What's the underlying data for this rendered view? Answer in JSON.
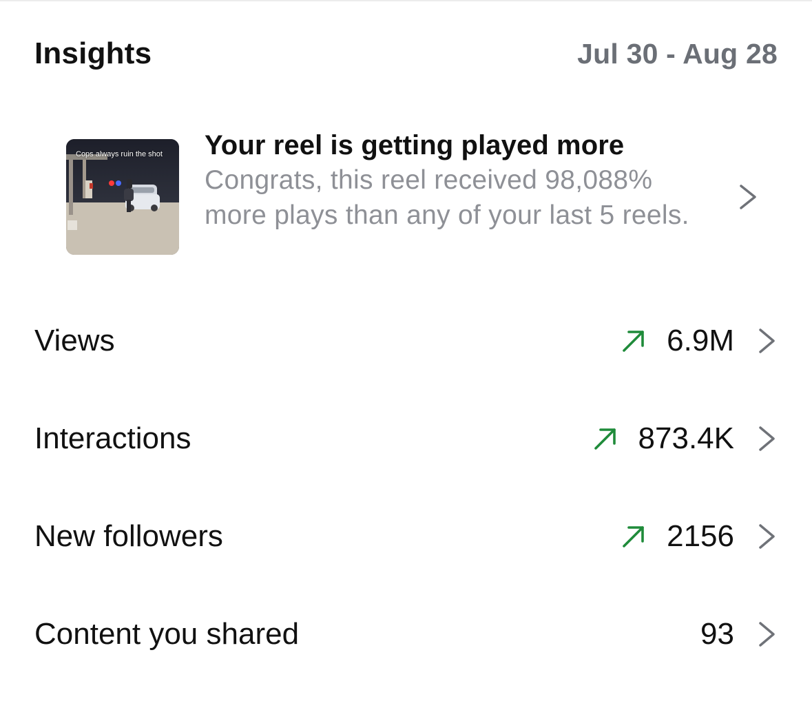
{
  "header": {
    "title": "Insights",
    "date_range": "Jul 30 - Aug 28"
  },
  "promo": {
    "thumbnail_caption": "Cops always ruin the shot",
    "title": "Your reel is getting played more",
    "body": "Congrats, this reel received 98,088% more plays than any of your last 5 reels."
  },
  "metrics": [
    {
      "label": "Views",
      "value": "6.9M",
      "trend": "up"
    },
    {
      "label": "Interactions",
      "value": "873.4K",
      "trend": "up"
    },
    {
      "label": "New followers",
      "value": "2156",
      "trend": "up"
    },
    {
      "label": "Content you shared",
      "value": "93",
      "trend": "none"
    }
  ],
  "colors": {
    "trend_up": "#1f8b3a",
    "secondary_text": "#8e9096",
    "date_text": "#6b6f76",
    "chevron": "#6f7278"
  },
  "icons": {
    "trend": "arrow-up-right-icon",
    "navigate": "chevron-right-icon"
  }
}
